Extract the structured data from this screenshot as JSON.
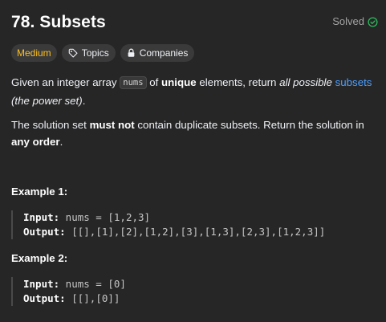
{
  "problem": {
    "title": "78. Subsets",
    "status": "Solved",
    "status_color": "#2cbb5d"
  },
  "tags": {
    "difficulty": "Medium",
    "difficulty_color": "#ffc01e",
    "topics": "Topics",
    "topics_icon": "tag-icon",
    "companies": "Companies",
    "companies_icon": "lock-icon"
  },
  "description": {
    "p1": {
      "t1": "Given an integer array ",
      "code": "nums",
      "t2": " of ",
      "bold1": "unique",
      "t3": " elements, return ",
      "italic1": "all possible",
      "t4": " ",
      "link": "subsets",
      "italic2": " (the power set)",
      "t5": "."
    },
    "p2": {
      "t1": "The solution set ",
      "bold1": "must not",
      "t2": " contain duplicate subsets. Return the solution in ",
      "bold2": "any order",
      "t3": "."
    }
  },
  "examples": [
    {
      "title": "Example 1:",
      "input_label": "Input:",
      "input_value": " nums = [1,2,3]",
      "output_label": "Output:",
      "output_value": " [[],[1],[2],[1,2],[3],[1,3],[2,3],[1,2,3]]"
    },
    {
      "title": "Example 2:",
      "input_label": "Input:",
      "input_value": " nums = [0]",
      "output_label": "Output:",
      "output_value": " [[],[0]]"
    }
  ]
}
